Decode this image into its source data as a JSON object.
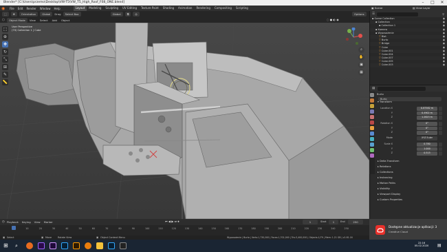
{
  "window": {
    "title": "Blender* [C:\\Users\\przemo\\Desktop\\VW-T5\\VW_T5_High_Roof_F08_ONE.blend]",
    "controls": [
      "–",
      "□",
      "✕"
    ]
  },
  "menubar": {
    "items": [
      "File",
      "Edit",
      "Render",
      "Window",
      "Help"
    ],
    "workspaces": [
      "Layout",
      "Modeling",
      "Sculpting",
      "UV Editing",
      "Texture Paint",
      "Shading",
      "Animation",
      "Rendering",
      "Compositing",
      "Scripting"
    ],
    "active_workspace": "Layout",
    "scene": "Scene",
    "view_layer": "View Layer"
  },
  "toolbar": {
    "mode": "Orientation",
    "orientation": "Global",
    "drag_label": "Drag",
    "drag_value": "Select Box",
    "pivot": "Global",
    "options": "Options"
  },
  "viewport_header": {
    "items": [
      "Object Mode",
      "View",
      "Select",
      "Add",
      "Object"
    ]
  },
  "viewport": {
    "info_line1": "User Perspective",
    "info_line2": "(70) Collection 1 | Cube"
  },
  "outliner": {
    "title": "Scene Collection",
    "rows": [
      {
        "label": "Scene Collection",
        "indent": 0,
        "sel": false
      },
      {
        "label": "Collection",
        "indent": 1,
        "sel": false
      },
      {
        "label": "Collection 1",
        "indent": 2,
        "sel": false
      },
      {
        "label": "Kamera",
        "indent": 1,
        "sel": false
      },
      {
        "label": "Wyposażenie",
        "indent": 1,
        "sel": false
      },
      {
        "label": "Blat",
        "indent": 2,
        "sel": false
      },
      {
        "label": "Burto",
        "indent": 2,
        "sel": false
      },
      {
        "label": "Bridge",
        "indent": 2,
        "sel": false
      },
      {
        "label": "Cube",
        "indent": 2,
        "sel": false
      },
      {
        "label": "Cube.001",
        "indent": 2,
        "sel": false
      },
      {
        "label": "Cube.004",
        "indent": 2,
        "sel": false
      },
      {
        "label": "Cube.007",
        "indent": 2,
        "sel": false
      },
      {
        "label": "Cube.005",
        "indent": 2,
        "sel": false
      },
      {
        "label": "Cube.003",
        "indent": 2,
        "sel": false
      }
    ]
  },
  "properties": {
    "object_name": "Burto",
    "object_name2": "Burto",
    "transform_title": "Transform",
    "location_label": "Location X",
    "loc": [
      "0.87582 m",
      "0.4902 m",
      "1.2823 m"
    ],
    "rot_label": "Rotation X",
    "rot": [
      "0°",
      "0°",
      "0°"
    ],
    "mode_label": "Mode",
    "mode_value": "XYZ Euler",
    "scale_label": "Scale X",
    "scale": [
      "0.780",
      "1.000",
      "0.515"
    ],
    "axis_y": "Y",
    "axis_z": "Z",
    "sections": [
      "Delta Transform",
      "Relations",
      "Collections",
      "Instancing",
      "Motion Paths",
      "Visibility",
      "Viewport Display",
      "Custom Properties"
    ]
  },
  "timeline": {
    "menu": [
      "Playback",
      "Keying",
      "View",
      "Marker"
    ],
    "frame_current": "1",
    "start_label": "Start",
    "start": "1",
    "end_label": "End",
    "end": "250",
    "ticks": [
      "0",
      "10",
      "20",
      "30",
      "40",
      "50",
      "60",
      "70",
      "80",
      "90",
      "100",
      "110",
      "120",
      "130",
      "140",
      "150",
      "160",
      "170",
      "180",
      "190",
      "200",
      "210",
      "220",
      "230",
      "240",
      "250"
    ]
  },
  "statusbar": {
    "select": "Select",
    "move": "Move",
    "rotate_view": "Rotate View",
    "context_menu": "Object Context Menu",
    "stats": "Wyposażenie | Burto | Verts:1,730,000 | Faces:1,702,000 | Tris:3,400,000 | Objects:1/79 | Mem: 1.21 GB | v2.81.16"
  },
  "notification": {
    "title": "Dostępne aktualizacje aplikacji: 3",
    "subtitle": "Creative Cloud"
  },
  "taskbar": {
    "time": "22:16",
    "date": "05.02.2020",
    "apps": [
      "windows-start",
      "search",
      "firefox",
      "premiere",
      "after-effects",
      "photoshop",
      "illustrator",
      "blender",
      "explorer",
      "ps-alt",
      "media"
    ]
  },
  "colors": {
    "accent": "#4772b3",
    "selection": "#334d80",
    "gizmo_x": "#e4504c",
    "gizmo_y": "#78b04a",
    "gizmo_z": "#4e86d4",
    "notif_icon": "#e8302a"
  }
}
